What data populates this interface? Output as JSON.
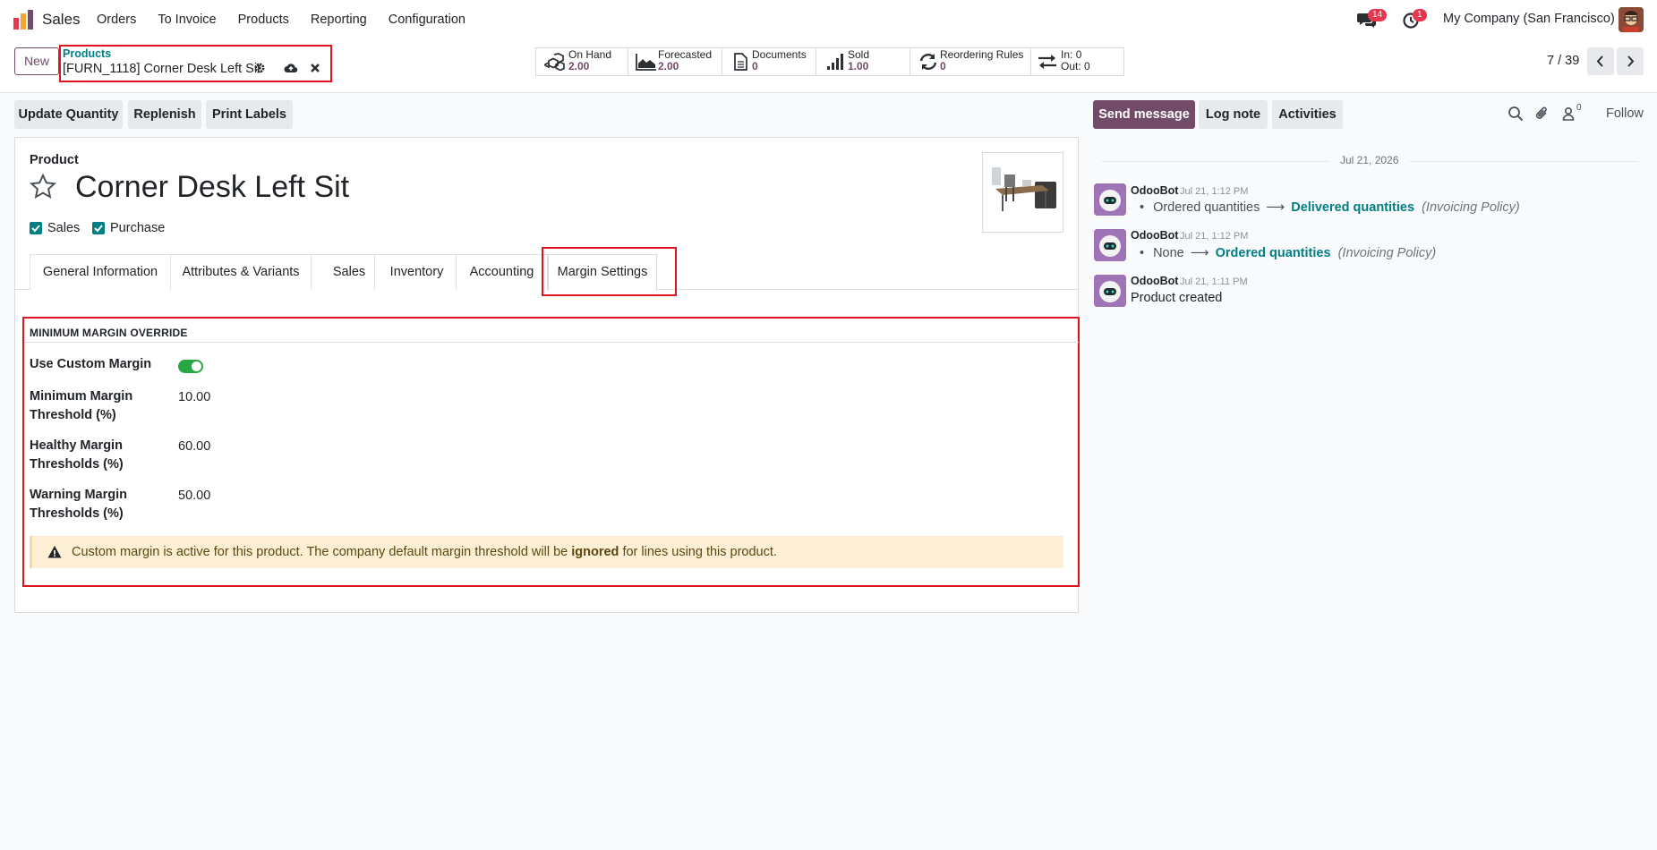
{
  "navbar": {
    "app_name": "Sales",
    "menu": [
      "Orders",
      "To Invoice",
      "Products",
      "Reporting",
      "Configuration"
    ],
    "messages_count": "14",
    "activities_count": "1",
    "company": "My Company (San Francisco)"
  },
  "control_panel": {
    "new_label": "New",
    "breadcrumb_parent": "Products",
    "breadcrumb_current": "[FURN_1118] Corner Desk Left Sit",
    "stats": [
      {
        "label": "On Hand",
        "value": "2.00",
        "icon": "cubes-icon"
      },
      {
        "label": "Forecasted",
        "value": "2.00",
        "icon": "area-chart-icon"
      },
      {
        "label": "Documents",
        "value": "0",
        "icon": "document-icon"
      },
      {
        "label": "Sold",
        "value": "1.00",
        "icon": "signal-bars-icon"
      },
      {
        "label": "Reordering Rules",
        "value": "0",
        "icon": "refresh-icon"
      },
      {
        "in_label": "In:",
        "in_value": "0",
        "out_label": "Out:",
        "out_value": "0",
        "icon": "exchange-arrows-icon"
      }
    ],
    "pager": "7 / 39"
  },
  "actions": {
    "update_quantity": "Update Quantity",
    "replenish": "Replenish",
    "print_labels": "Print Labels"
  },
  "form": {
    "product_label": "Product",
    "product_name": "Corner Desk Left Sit",
    "sales_label": "Sales",
    "purchase_label": "Purchase",
    "tabs": [
      "General Information",
      "Attributes & Variants",
      "Sales",
      "Inventory",
      "Accounting",
      "Margin Settings"
    ],
    "active_tab": "Margin Settings",
    "section_title": "MINIMUM MARGIN OVERRIDE",
    "fields": {
      "use_custom_margin_label": "Use Custom Margin",
      "use_custom_margin_value": true,
      "min_threshold_label": "Minimum Margin Threshold (%)",
      "min_threshold_value": "10.00",
      "healthy_label": "Healthy Margin Thresholds (%)",
      "healthy_value": "60.00",
      "warning_label": "Warning Margin Thresholds (%)",
      "warning_value": "50.00"
    },
    "alert": {
      "before": "Custom margin is active for this product. The company default margin threshold will be ",
      "bold": "ignored",
      "after": " for lines using this product."
    }
  },
  "chatter": {
    "send_message": "Send message",
    "log_note": "Log note",
    "activities": "Activities",
    "followers_count": "0",
    "follow": "Follow",
    "date": "Jul 21, 2026",
    "messages": [
      {
        "author": "OdooBot",
        "time": "Jul 21, 1:12 PM",
        "old": "Ordered quantities",
        "new": "Delivered quantities",
        "field": "(Invoicing Policy)"
      },
      {
        "author": "OdooBot",
        "time": "Jul 21, 1:12 PM",
        "old": "None",
        "new": "Ordered quantities",
        "field": "(Invoicing Policy)"
      },
      {
        "author": "OdooBot",
        "time": "Jul 21, 1:11 PM",
        "body": "Product created"
      }
    ]
  },
  "colors": {
    "brand": "#714b67",
    "teal": "#017e84",
    "highlight": "#e0131e",
    "toggle_on": "#28a745"
  }
}
